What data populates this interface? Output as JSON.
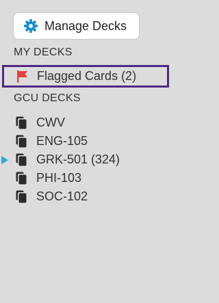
{
  "manage_button": {
    "label": "Manage Decks",
    "icon": "gear-icon",
    "icon_color": "#1a8fcf"
  },
  "my_decks": {
    "header": "MY DECKS",
    "flagged": {
      "label": "Flagged Cards (2)",
      "icon": "flag-icon",
      "icon_color": "#e8423b",
      "highlight_color": "#4e2a84"
    }
  },
  "gcu_decks": {
    "header": "GCU DECKS",
    "items": [
      {
        "label": "CWV",
        "icon": "cards-icon"
      },
      {
        "label": "ENG-105",
        "icon": "cards-icon"
      },
      {
        "label": "GRK-501 (324)",
        "icon": "cards-icon",
        "current": true
      },
      {
        "label": "PHI-103",
        "icon": "cards-icon"
      },
      {
        "label": "SOC-102",
        "icon": "cards-icon"
      }
    ],
    "current_marker_color": "#29a8e0"
  },
  "colors": {
    "background": "#dcdcdc",
    "text": "#333333"
  }
}
